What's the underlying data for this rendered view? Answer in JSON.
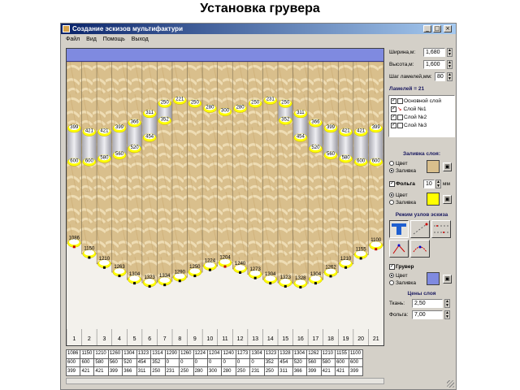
{
  "slide": {
    "title": "Установка грувера"
  },
  "window": {
    "title": "Создание эскизов мультифактури",
    "controls": {
      "minimize": "_",
      "maximize": "□",
      "close": "×"
    },
    "menu": [
      "Файл",
      "Вид",
      "Помощь",
      "Выход"
    ]
  },
  "params": {
    "width_label": "Ширина,м:",
    "width_value": "1,680",
    "height_label": "Высота,м:",
    "height_value": "1,600",
    "step_label": "Шаг ламелей,мм:",
    "step_value": "80",
    "lamels_label": "Ламелей = 21"
  },
  "layers": [
    {
      "label": "Основной слой",
      "checked": true
    },
    {
      "label": "Слой №1",
      "checked": true
    },
    {
      "label": "Слой №2",
      "checked": true
    },
    {
      "label": "Слой №3",
      "checked": true
    }
  ],
  "fill_section": {
    "title": "Заливка слоя:",
    "opt_color": "Цвет",
    "opt_fill": "Заливка",
    "foil_label": "Фольга",
    "foil_value": "10",
    "foil_unit": "мм",
    "opt_color2": "Цвет",
    "opt_fill2": "Заливка",
    "swatch_yellow": "#ffff00"
  },
  "node_mode": {
    "title": "Режим узлов эскиза"
  },
  "groover": {
    "label": "Грувер",
    "opt_color": "Цвет",
    "opt_fill": "Заливка",
    "swatch": "#7f8ae0"
  },
  "prices": {
    "title": "Цены слоя",
    "fabric_label": "Ткань:",
    "fabric_value": "2,50",
    "foil_label": "Фольга:",
    "foil_value": "7,00"
  },
  "colors": {
    "bluebar": "#7f8ae0",
    "marker": "#ffff00"
  },
  "lamel_numbers": [
    "1",
    "2",
    "3",
    "4",
    "5",
    "6",
    "7",
    "8",
    "9",
    "10",
    "11",
    "12",
    "13",
    "14",
    "15",
    "16",
    "17",
    "18",
    "19",
    "20",
    "21"
  ],
  "grid_rows": [
    [
      "1086",
      "1150",
      "1210",
      "1260",
      "1304",
      "1323",
      "1314",
      "1290",
      "1260",
      "1224",
      "1204",
      "1240",
      "1273",
      "1304",
      "1323",
      "1328",
      "1304",
      "1262",
      "1210",
      "1155",
      "1100"
    ],
    [
      "600",
      "600",
      "580",
      "560",
      "520",
      "454",
      "352",
      "0",
      "0",
      "0",
      "0",
      "0",
      "0",
      "0",
      "352",
      "454",
      "520",
      "560",
      "580",
      "600",
      "600"
    ],
    [
      "399",
      "421",
      "421",
      "399",
      "366",
      "311",
      "250",
      "231",
      "250",
      "280",
      "300",
      "280",
      "250",
      "231",
      "250",
      "311",
      "366",
      "399",
      "421",
      "421",
      "399"
    ]
  ],
  "chart_data": {
    "type": "table",
    "x": [
      "1",
      "2",
      "3",
      "4",
      "5",
      "6",
      "7",
      "8",
      "9",
      "10",
      "11",
      "12",
      "13",
      "14",
      "15",
      "16",
      "17",
      "18",
      "19",
      "20",
      "21"
    ],
    "groover": [
      1086,
      1150,
      1210,
      1260,
      1304,
      1323,
      1314,
      1290,
      1260,
      1224,
      1204,
      1240,
      1273,
      1304,
      1323,
      1328,
      1304,
      1262,
      1210,
      1155,
      1100
    ],
    "layer1": [
      600,
      600,
      580,
      560,
      520,
      454,
      352,
      0,
      0,
      0,
      0,
      0,
      0,
      0,
      352,
      454,
      520,
      560,
      580,
      600,
      600
    ],
    "layer_top": [
      399,
      421,
      421,
      399,
      366,
      311,
      250,
      231,
      250,
      280,
      300,
      280,
      250,
      231,
      250,
      311,
      366,
      399,
      421,
      421,
      399
    ],
    "canvas_label_top": [
      "399",
      "421",
      "421",
      "399",
      "366",
      "311",
      "250",
      "221",
      "250",
      "280",
      "300",
      "280",
      "250",
      "231",
      "250",
      "311",
      "366",
      "399",
      "421",
      "421",
      "399"
    ],
    "canvas_label_mid": [
      "600",
      "600",
      "580",
      "560",
      "520",
      "454",
      "352",
      "",
      "",
      "",
      "",
      "",
      "",
      "",
      "352",
      "454",
      "520",
      "560",
      "580",
      "600",
      "600"
    ],
    "canvas_label_bottom": [
      "1086",
      "1150",
      "1210",
      "1263",
      "1304",
      "1323",
      "1334",
      "1290",
      "1250",
      "1224",
      "1204",
      "1240",
      "1273",
      "1304",
      "1323",
      "1328",
      "1304",
      "1262",
      "1210",
      "1155",
      "1100"
    ],
    "max_height": 1600
  }
}
